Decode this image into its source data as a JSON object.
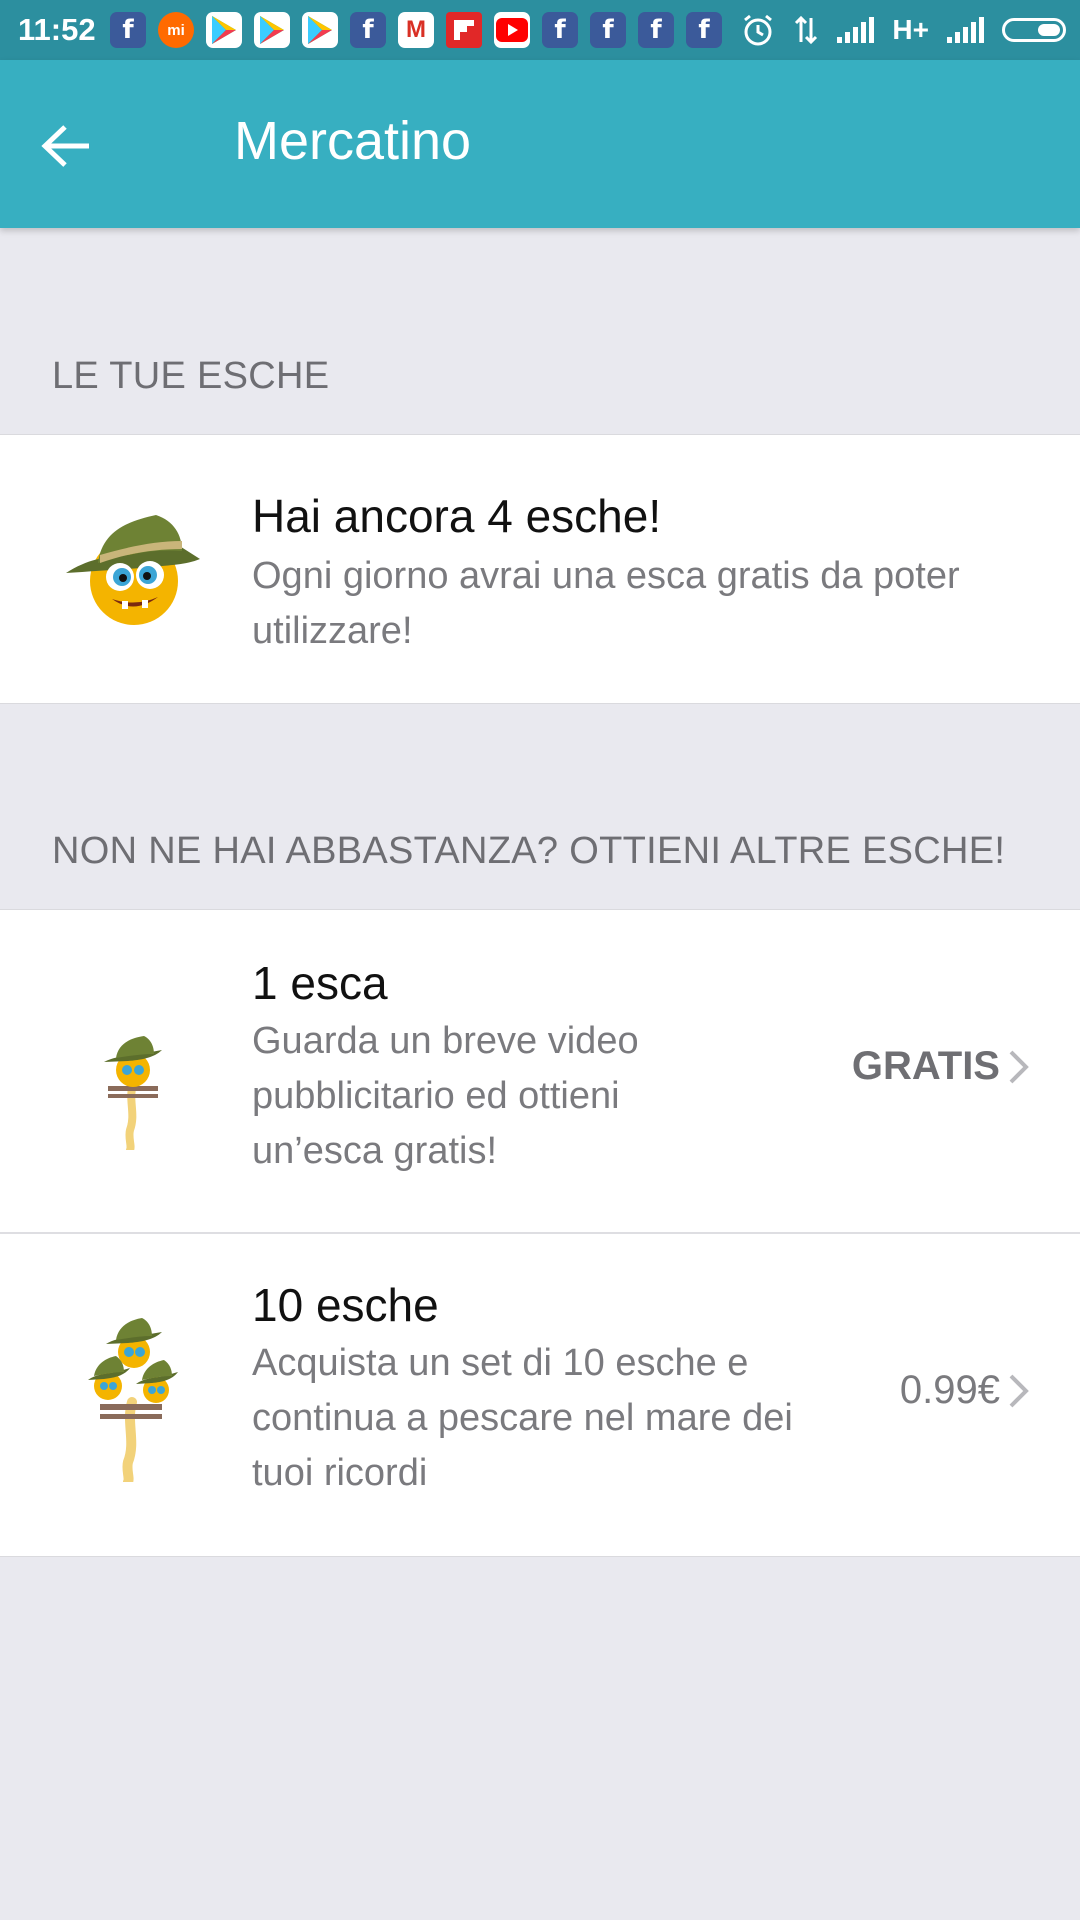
{
  "status_bar": {
    "time": "11:52",
    "network": "H+",
    "notification_icons": [
      "facebook-icon",
      "mi-icon",
      "play-store-icon",
      "play-store-icon",
      "play-store-icon",
      "facebook-icon",
      "gmail-icon",
      "flipboard-icon",
      "youtube-icon",
      "facebook-icon",
      "facebook-icon",
      "facebook-icon",
      "facebook-icon"
    ]
  },
  "appbar": {
    "title": "Mercatino"
  },
  "sections": {
    "your_baits": "LE TUE ESCHE",
    "get_more": "NON NE HAI ABBASTANZA? OTTIENI ALTRE ESCHE!"
  },
  "bait_status": {
    "title": "Hai ancora  4 esche!",
    "description": "Ogni giorno avrai una esca gratis da poter utilizzare!"
  },
  "offers": [
    {
      "title": "1 esca",
      "description": "Guarda un breve video pubblicitario ed ottieni un’esca gratis!",
      "price": "GRATIS"
    },
    {
      "title": "10 esche",
      "description": "Acquista un set di 10 esche e continua a pescare nel mare dei tuoi ricordi",
      "price": "0.99€"
    }
  ],
  "colors": {
    "status_bar": "#2C8F9F",
    "app_bar": "#37AFC1",
    "background": "#E9E9EF"
  }
}
